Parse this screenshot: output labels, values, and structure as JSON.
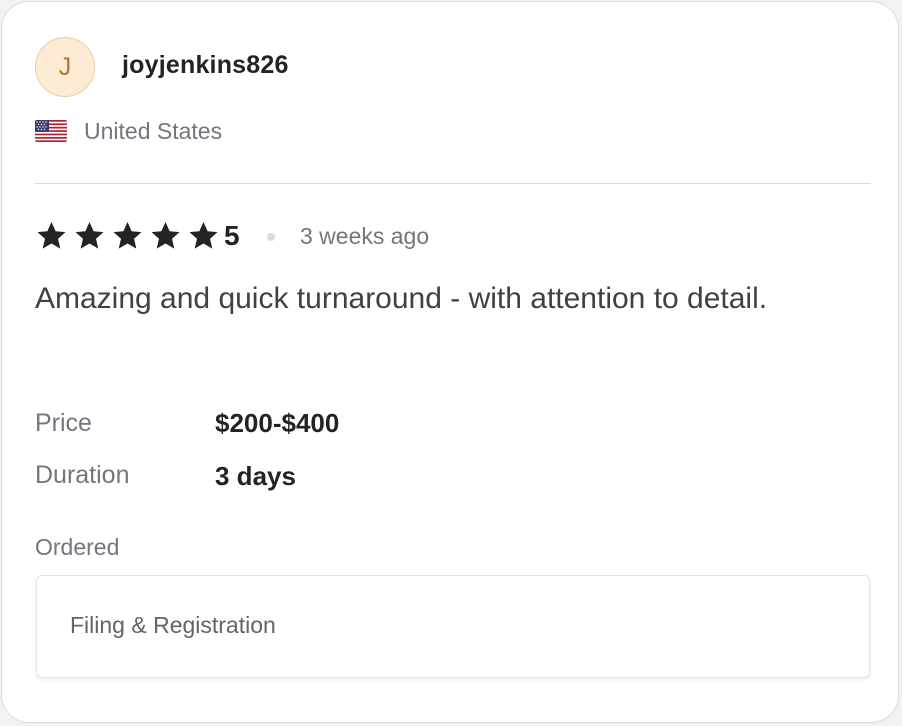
{
  "reviewer": {
    "avatar_initial": "J",
    "username": "joyjenkins826",
    "country": "United States",
    "flag_icon": "us-flag-icon"
  },
  "review": {
    "stars": 5,
    "rating": "5",
    "time_ago": "3 weeks ago",
    "text": "Amazing and quick turnaround - with attention to detail."
  },
  "details": {
    "price_label": "Price",
    "price_value": "$200-$400",
    "duration_label": "Duration",
    "duration_value": "3 days"
  },
  "ordered": {
    "label": "Ordered",
    "item": "Filing & Registration"
  },
  "colors": {
    "star": "#222325",
    "avatar_bg": "#fdebd3",
    "avatar_text": "#b07a2a",
    "muted_text": "#74767e"
  }
}
